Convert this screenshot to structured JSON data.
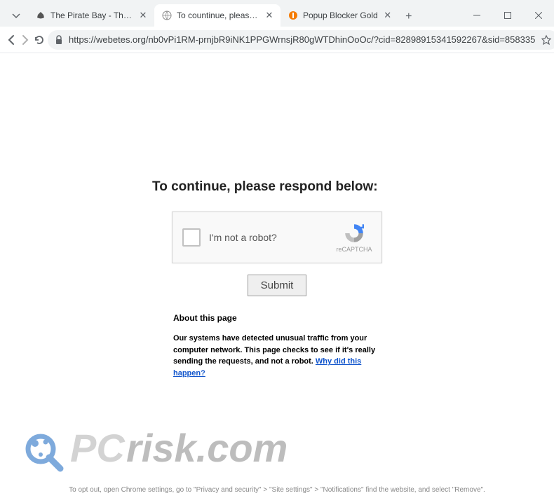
{
  "tabs": [
    {
      "title": "The Pirate Bay - The galaxy's m"
    },
    {
      "title": "To countinue, please respond b"
    },
    {
      "title": "Popup Blocker Gold"
    }
  ],
  "url": "https://webetes.org/nb0vPi1RM-prnjbR9iNK1PPGWrnsjR80gWTDhinOoOc/?cid=82898915341592267&sid=858335",
  "page": {
    "heading": "To continue, please respond below:",
    "captcha_label": "I'm not a robot?",
    "captcha_brand": "reCAPTCHA",
    "submit": "Submit",
    "about_heading": "About this page",
    "about_body": "Our systems have detected unusual traffic from your computer network. This page checks to see if it's really sending the requests, and not a robot. ",
    "about_link": "Why did this happen?"
  },
  "watermark": {
    "text1": "PC",
    "text2": "risk.com"
  },
  "footer": "To opt out, open Chrome settings, go to \"Privacy and security\" > \"Site settings\" > \"Notifications\" find the website, and select \"Remove\"."
}
